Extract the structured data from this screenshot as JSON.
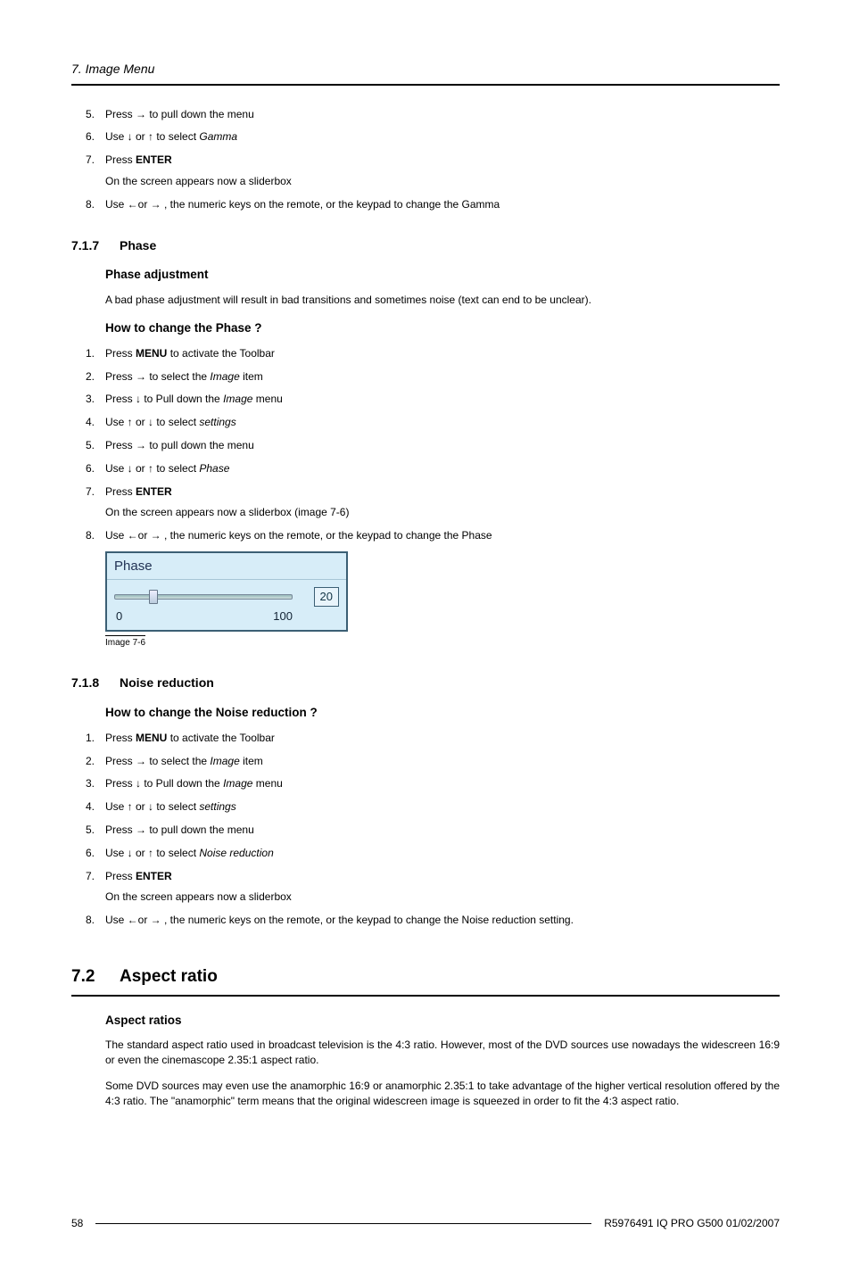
{
  "header": {
    "title": "7.  Image Menu"
  },
  "gamma_continued": {
    "steps": [
      {
        "n": "5.",
        "pre": "Press → to pull down the menu"
      },
      {
        "n": "6.",
        "pre": "Use ↓ or ↑ to select ",
        "em": "Gamma"
      },
      {
        "n": "7.",
        "pre": "Press ",
        "strong": "ENTER"
      },
      {
        "note": "On the screen appears now a sliderbox"
      },
      {
        "n": "8.",
        "pre": "Use ←or → , the numeric keys on the remote, or the keypad to change the Gamma"
      }
    ]
  },
  "s717": {
    "num": "7.1.7",
    "title": "Phase",
    "h1": "Phase adjustment",
    "p1": "A bad phase adjustment will result in bad transitions and sometimes noise (text can end to be unclear).",
    "h2": "How to change the Phase ?",
    "steps": [
      {
        "n": "1.",
        "pre": "Press ",
        "strong": "MENU",
        "post": " to activate the Toolbar"
      },
      {
        "n": "2.",
        "pre": "Press → to select the ",
        "em": "Image",
        "post": " item"
      },
      {
        "n": "3.",
        "pre": "Press ↓ to Pull down the ",
        "em": "Image",
        "post": " menu"
      },
      {
        "n": "4.",
        "pre": "Use ↑ or ↓ to select ",
        "em": "settings"
      },
      {
        "n": "5.",
        "pre": "Press → to pull down the menu"
      },
      {
        "n": "6.",
        "pre": "Use ↓ or ↑ to select ",
        "em": "Phase"
      },
      {
        "n": "7.",
        "pre": "Press ",
        "strong": "ENTER"
      },
      {
        "note": "On the screen appears now a sliderbox (image 7-6)"
      },
      {
        "n": "8.",
        "pre": "Use ←or → , the numeric keys on the remote, or the keypad to change the Phase"
      }
    ],
    "slider": {
      "title": "Phase",
      "min": "0",
      "max": "100",
      "value": "20"
    },
    "caption": "Image 7-6"
  },
  "s718": {
    "num": "7.1.8",
    "title": "Noise reduction",
    "h1": "How to change the Noise reduction ?",
    "steps": [
      {
        "n": "1.",
        "pre": "Press ",
        "strong": "MENU",
        "post": " to activate the Toolbar"
      },
      {
        "n": "2.",
        "pre": "Press → to select the ",
        "em": "Image",
        "post": " item"
      },
      {
        "n": "3.",
        "pre": "Press ↓ to Pull down the ",
        "em": "Image",
        "post": " menu"
      },
      {
        "n": "4.",
        "pre": "Use ↑ or ↓ to select ",
        "em": "settings"
      },
      {
        "n": "5.",
        "pre": "Press → to pull down the menu"
      },
      {
        "n": "6.",
        "pre": "Use ↓ or ↑ to select ",
        "em": "Noise reduction"
      },
      {
        "n": "7.",
        "pre": "Press ",
        "strong": "ENTER"
      },
      {
        "note": "On the screen appears now a sliderbox"
      },
      {
        "n": "8.",
        "pre": "Use ←or → , the numeric keys on the remote, or the keypad to change the Noise reduction setting."
      }
    ]
  },
  "s72": {
    "num": "7.2",
    "title": "Aspect ratio",
    "h1": "Aspect ratios",
    "p1": "The standard aspect ratio used in broadcast television is the 4:3 ratio.  However, most of the DVD sources use nowadays the widescreen 16:9 or even the cinemascope 2.35:1 aspect ratio.",
    "p2": "Some DVD sources may even use the anamorphic 16:9 or anamorphic 2.35:1 to take advantage of the higher vertical resolution offered by the 4:3 ratio. The \"anamorphic\" term means that the original widescreen image is squeezed in order to fit the 4:3 aspect ratio."
  },
  "footer": {
    "page": "58",
    "doc": "R5976491  IQ PRO G500  01/02/2007"
  }
}
